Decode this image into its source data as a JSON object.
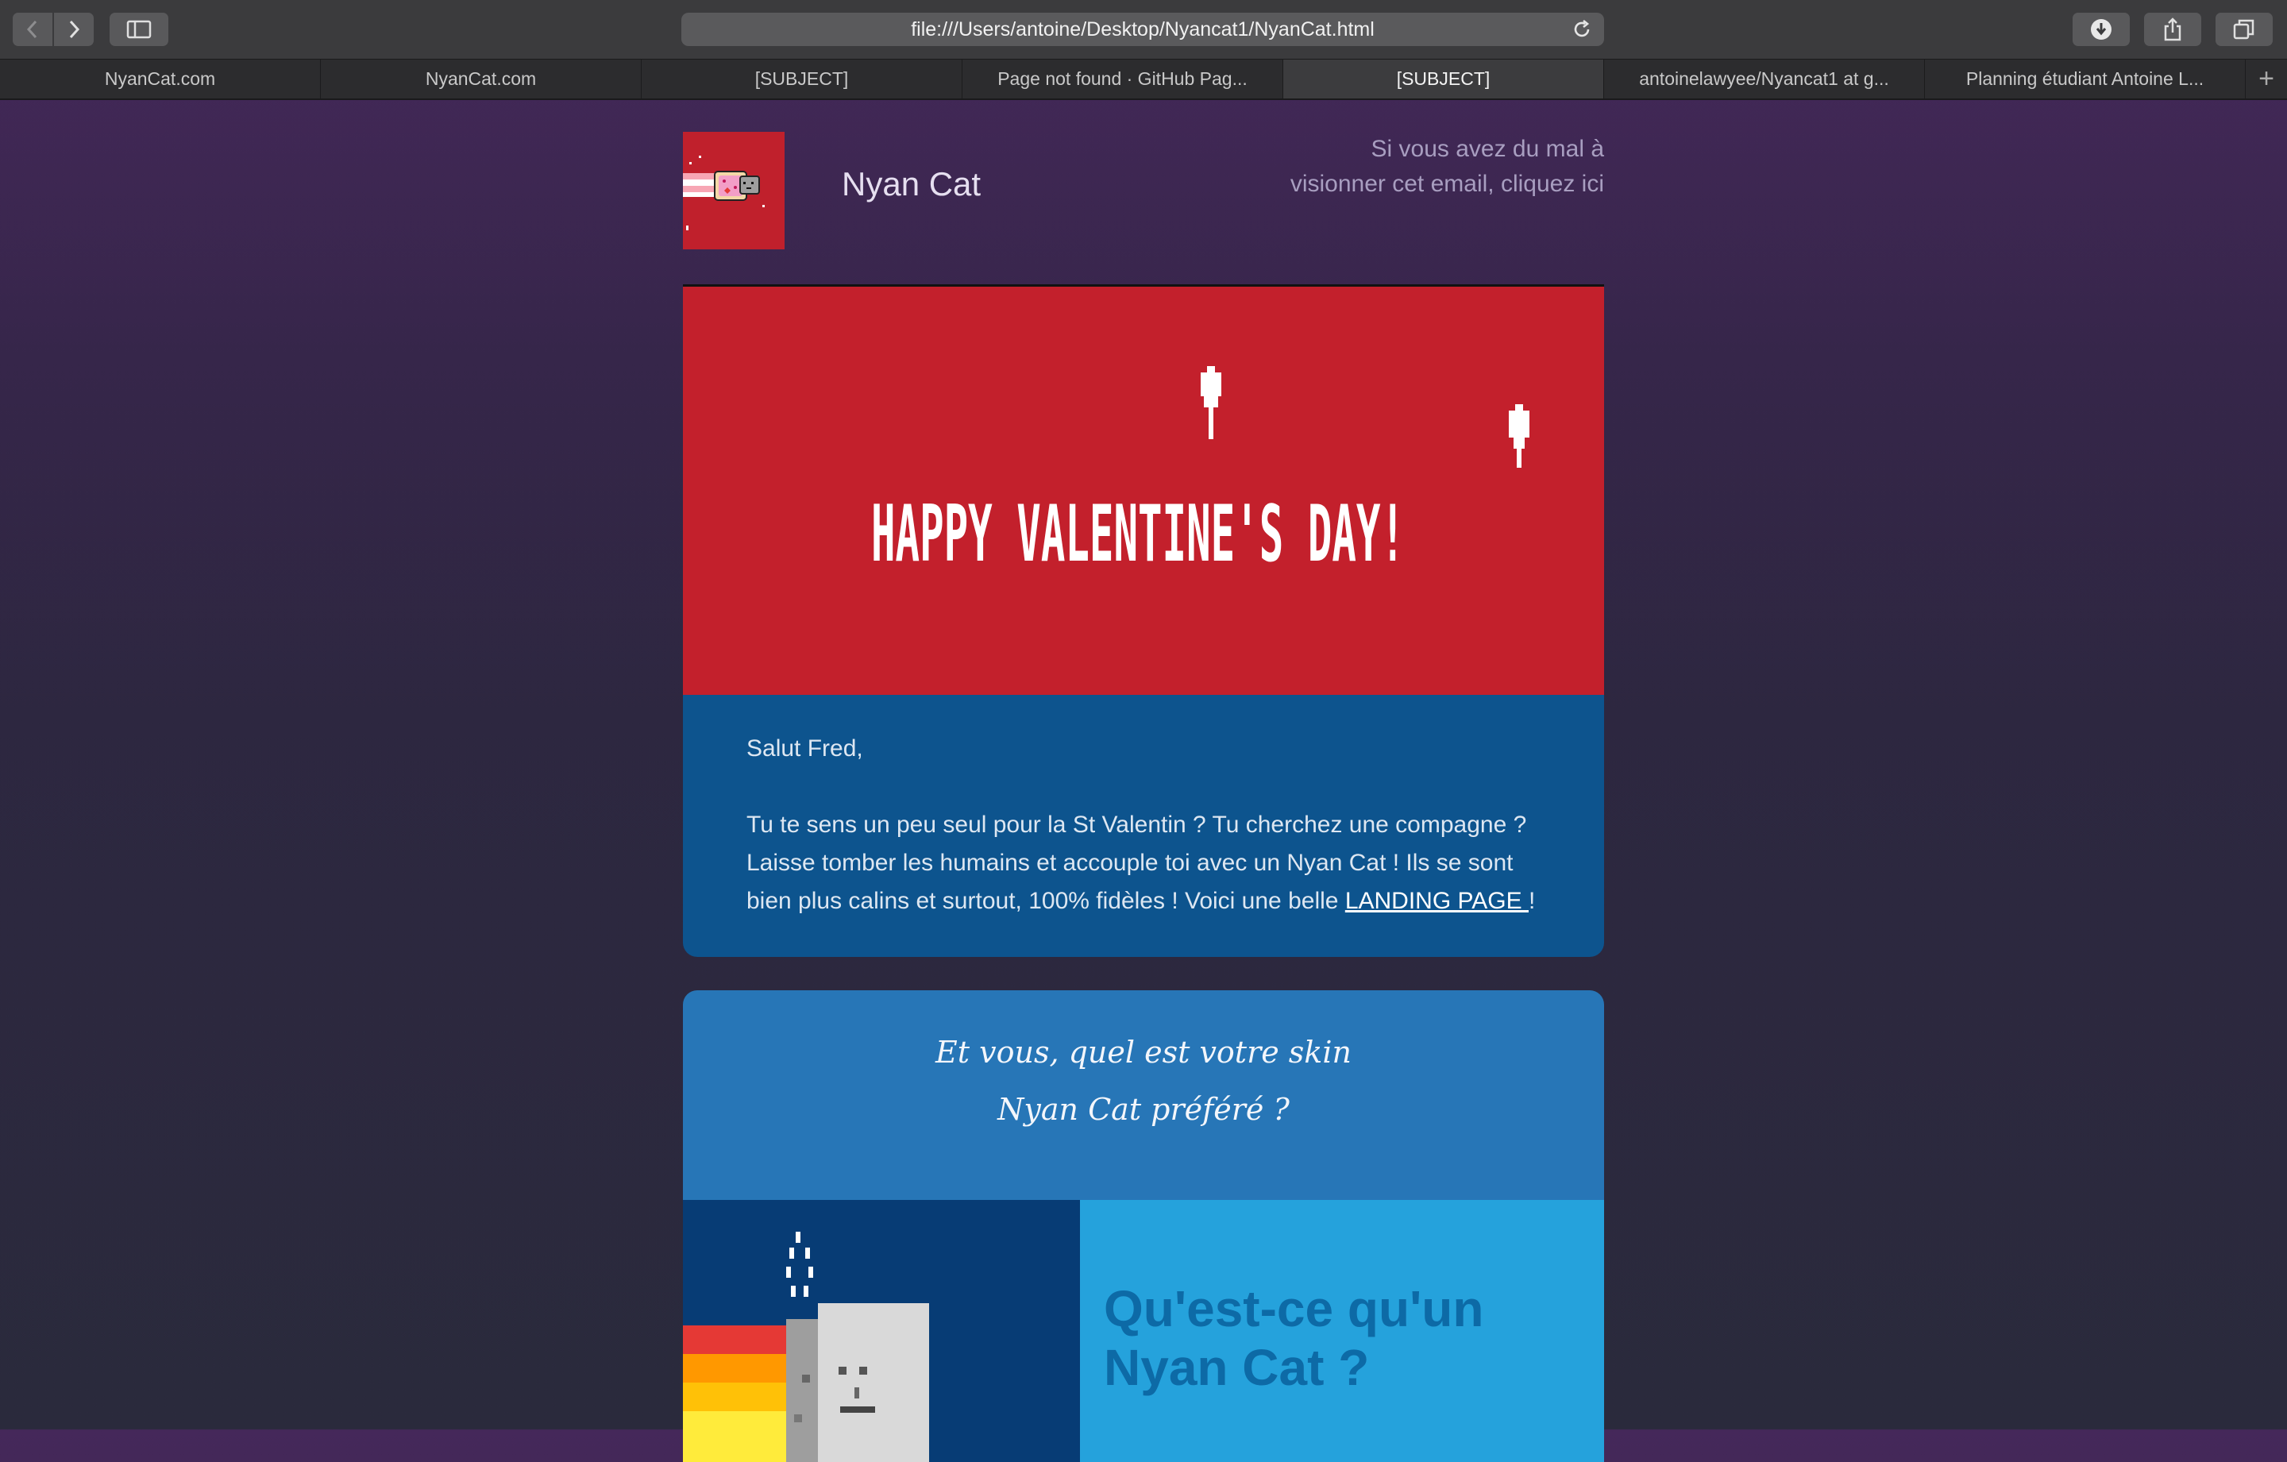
{
  "browser": {
    "url": "file:///Users/antoine/Desktop/Nyancat1/NyanCat.html",
    "tabs": [
      {
        "label": "NyanCat.com"
      },
      {
        "label": "NyanCat.com"
      },
      {
        "label": "[SUBJECT]"
      },
      {
        "label": "Page not found · GitHub Pag..."
      },
      {
        "label": "[SUBJECT]"
      },
      {
        "label": "antoinelawyee/Nyancat1 at g..."
      },
      {
        "label": "Planning étudiant Antoine L..."
      }
    ],
    "active_tab_index": 4,
    "add_tab": "+"
  },
  "email": {
    "brand": "Nyan Cat",
    "view_link": "Si vous avez du mal à visionner cet email, cliquez ici",
    "hero_text": "HAPPY VALENTINE'S DAY!",
    "greeting": "Salut Fred,",
    "body_text": "Tu te sens un peu seul pour la St Valentin ? Tu cherchez une compagne ? Laisse tomber les humains et accouple toi avec un Nyan Cat ! Ils se sont bien plus calins et surtout, 100% fidèles ! Voici une belle",
    "landing_link": "LANDING PAGE ",
    "body_end": "!",
    "skin_line1": "Et vous, quel est votre skin",
    "skin_line2": "Nyan Cat préféré ?",
    "question": "Qu'est-ce qu'un Nyan Cat ?"
  },
  "colors": {
    "hero_red": "#c3202c",
    "intro_blue": "#0d548e",
    "skin_blue": "#2776b7",
    "dark_blue": "#073c75",
    "light_blue": "#25a2dc"
  },
  "icons": [
    "back-arrow-icon",
    "forward-arrow-icon",
    "sidebar-icon",
    "reload-icon",
    "download-icon",
    "share-icon",
    "tabs-overview-icon"
  ]
}
